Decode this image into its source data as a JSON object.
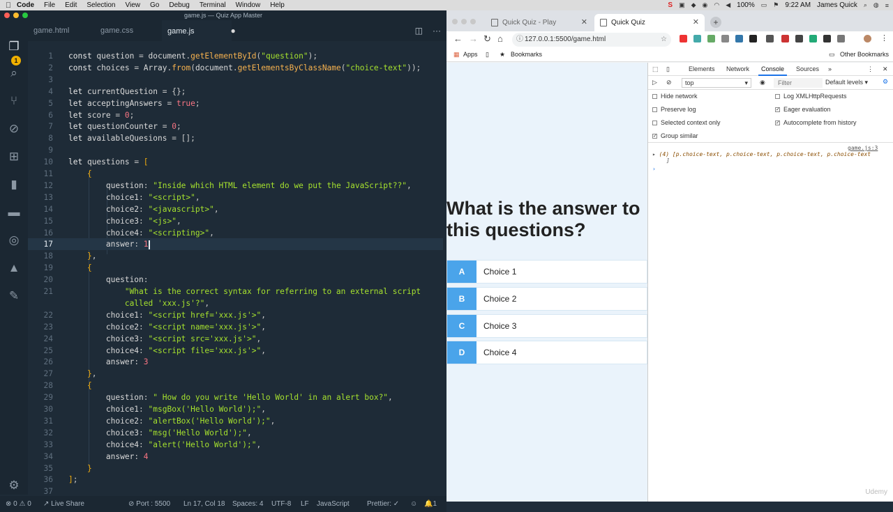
{
  "menubar": {
    "app": "Code",
    "items": [
      "File",
      "Edit",
      "Selection",
      "View",
      "Go",
      "Debug",
      "Terminal",
      "Window",
      "Help"
    ],
    "battery": "100%",
    "time": "9:22 AM",
    "user": "James Quick"
  },
  "vscode": {
    "title": "game.js — Quiz App Master",
    "tabs": [
      {
        "label": "game.html"
      },
      {
        "label": "game.css"
      },
      {
        "label": "game.js"
      }
    ],
    "notification_count": "1",
    "status": {
      "errors": "0",
      "warnings": "0",
      "live_share": "Live Share",
      "port": "Port : 5500",
      "position": "Ln 17, Col 18",
      "spaces": "Spaces: 4",
      "encoding": "UTF-8",
      "eol": "LF",
      "language": "JavaScript",
      "prettier": "Prettier:",
      "bell_count": "1"
    }
  },
  "code_lines": [
    {
      "n": "1",
      "tokens": [
        [
          "k",
          "const "
        ],
        [
          "v",
          "question "
        ],
        [
          "p",
          "= "
        ],
        [
          "v",
          "document"
        ],
        [
          "p",
          "."
        ],
        [
          "f",
          "getElementById"
        ],
        [
          "p",
          "("
        ],
        [
          "s",
          "\"question\""
        ],
        [
          "p",
          ");"
        ]
      ]
    },
    {
      "n": "2",
      "tokens": [
        [
          "k",
          "const "
        ],
        [
          "v",
          "choices "
        ],
        [
          "p",
          "= "
        ],
        [
          "v",
          "Array"
        ],
        [
          "p",
          "."
        ],
        [
          "f",
          "from"
        ],
        [
          "p",
          "("
        ],
        [
          "v",
          "document"
        ],
        [
          "p",
          "."
        ],
        [
          "f",
          "getElementsByClassName"
        ],
        [
          "p",
          "("
        ],
        [
          "s",
          "\"choice-text\""
        ],
        [
          "p",
          "));"
        ]
      ]
    },
    {
      "n": "3",
      "tokens": []
    },
    {
      "n": "4",
      "tokens": [
        [
          "k",
          "let "
        ],
        [
          "v",
          "currentQuestion "
        ],
        [
          "p",
          "= {};"
        ]
      ]
    },
    {
      "n": "5",
      "tokens": [
        [
          "k",
          "let "
        ],
        [
          "v",
          "acceptingAnswers "
        ],
        [
          "p",
          "= "
        ],
        [
          "n",
          "true"
        ],
        [
          "p",
          ";"
        ]
      ]
    },
    {
      "n": "6",
      "tokens": [
        [
          "k",
          "let "
        ],
        [
          "v",
          "score "
        ],
        [
          "p",
          "= "
        ],
        [
          "n",
          "0"
        ],
        [
          "p",
          ";"
        ]
      ]
    },
    {
      "n": "7",
      "tokens": [
        [
          "k",
          "let "
        ],
        [
          "v",
          "questionCounter "
        ],
        [
          "p",
          "= "
        ],
        [
          "n",
          "0"
        ],
        [
          "p",
          ";"
        ]
      ]
    },
    {
      "n": "8",
      "tokens": [
        [
          "k",
          "let "
        ],
        [
          "v",
          "availableQuesions "
        ],
        [
          "p",
          "= [];"
        ]
      ]
    },
    {
      "n": "9",
      "tokens": []
    },
    {
      "n": "10",
      "tokens": [
        [
          "k",
          "let "
        ],
        [
          "v",
          "questions "
        ],
        [
          "p",
          "= "
        ],
        [
          "b",
          "["
        ]
      ]
    },
    {
      "n": "11",
      "tokens": [
        [
          "p",
          "    "
        ],
        [
          "b",
          "{"
        ]
      ]
    },
    {
      "n": "12",
      "tokens": [
        [
          "p",
          "        "
        ],
        [
          "v",
          "question"
        ],
        [
          "p",
          ": "
        ],
        [
          "s",
          "\"Inside which HTML element do we put the JavaScript??\""
        ],
        [
          "p",
          ","
        ]
      ]
    },
    {
      "n": "13",
      "tokens": [
        [
          "p",
          "        "
        ],
        [
          "v",
          "choice1"
        ],
        [
          "p",
          ": "
        ],
        [
          "s",
          "\"<script>\""
        ],
        [
          "p",
          ","
        ]
      ]
    },
    {
      "n": "14",
      "tokens": [
        [
          "p",
          "        "
        ],
        [
          "v",
          "choice2"
        ],
        [
          "p",
          ": "
        ],
        [
          "s",
          "\"<javascript>\""
        ],
        [
          "p",
          ","
        ]
      ]
    },
    {
      "n": "15",
      "tokens": [
        [
          "p",
          "        "
        ],
        [
          "v",
          "choice3"
        ],
        [
          "p",
          ": "
        ],
        [
          "s",
          "\"<js>\""
        ],
        [
          "p",
          ","
        ]
      ]
    },
    {
      "n": "16",
      "tokens": [
        [
          "p",
          "        "
        ],
        [
          "v",
          "choice4"
        ],
        [
          "p",
          ": "
        ],
        [
          "s",
          "\"<scripting>\""
        ],
        [
          "p",
          ","
        ]
      ]
    },
    {
      "n": "17",
      "tokens": [
        [
          "p",
          "        "
        ],
        [
          "v",
          "answer"
        ],
        [
          "p",
          ": "
        ],
        [
          "n",
          "1"
        ]
      ],
      "current": true
    },
    {
      "n": "18",
      "tokens": [
        [
          "p",
          "    "
        ],
        [
          "b",
          "}"
        ],
        [
          "p",
          ","
        ]
      ]
    },
    {
      "n": "19",
      "tokens": [
        [
          "p",
          "    "
        ],
        [
          "b",
          "{"
        ]
      ]
    },
    {
      "n": "20",
      "tokens": [
        [
          "p",
          "        "
        ],
        [
          "v",
          "question"
        ],
        [
          "p",
          ":"
        ]
      ]
    },
    {
      "n": "21",
      "tokens": [
        [
          "p",
          "            "
        ],
        [
          "s",
          "\"What is the correct syntax for referring to an external script"
        ]
      ]
    },
    {
      "n": "",
      "tokens": [
        [
          "p",
          "            "
        ],
        [
          "s",
          "called 'xxx.js'?\""
        ],
        [
          "p",
          ","
        ]
      ]
    },
    {
      "n": "22",
      "tokens": [
        [
          "p",
          "        "
        ],
        [
          "v",
          "choice1"
        ],
        [
          "p",
          ": "
        ],
        [
          "s",
          "\"<script href='xxx.js'>\""
        ],
        [
          "p",
          ","
        ]
      ]
    },
    {
      "n": "23",
      "tokens": [
        [
          "p",
          "        "
        ],
        [
          "v",
          "choice2"
        ],
        [
          "p",
          ": "
        ],
        [
          "s",
          "\"<script name='xxx.js'>\""
        ],
        [
          "p",
          ","
        ]
      ]
    },
    {
      "n": "24",
      "tokens": [
        [
          "p",
          "        "
        ],
        [
          "v",
          "choice3"
        ],
        [
          "p",
          ": "
        ],
        [
          "s",
          "\"<script src='xxx.js'>\""
        ],
        [
          "p",
          ","
        ]
      ]
    },
    {
      "n": "25",
      "tokens": [
        [
          "p",
          "        "
        ],
        [
          "v",
          "choice4"
        ],
        [
          "p",
          ": "
        ],
        [
          "s",
          "\"<script file='xxx.js'>\""
        ],
        [
          "p",
          ","
        ]
      ]
    },
    {
      "n": "26",
      "tokens": [
        [
          "p",
          "        "
        ],
        [
          "v",
          "answer"
        ],
        [
          "p",
          ": "
        ],
        [
          "n",
          "3"
        ]
      ]
    },
    {
      "n": "27",
      "tokens": [
        [
          "p",
          "    "
        ],
        [
          "b",
          "}"
        ],
        [
          "p",
          ","
        ]
      ]
    },
    {
      "n": "28",
      "tokens": [
        [
          "p",
          "    "
        ],
        [
          "b",
          "{"
        ]
      ]
    },
    {
      "n": "29",
      "tokens": [
        [
          "p",
          "        "
        ],
        [
          "v",
          "question"
        ],
        [
          "p",
          ": "
        ],
        [
          "s",
          "\" How do you write 'Hello World' in an alert box?\""
        ],
        [
          "p",
          ","
        ]
      ]
    },
    {
      "n": "30",
      "tokens": [
        [
          "p",
          "        "
        ],
        [
          "v",
          "choice1"
        ],
        [
          "p",
          ": "
        ],
        [
          "s",
          "\"msgBox('Hello World');\""
        ],
        [
          "p",
          ","
        ]
      ]
    },
    {
      "n": "31",
      "tokens": [
        [
          "p",
          "        "
        ],
        [
          "v",
          "choice2"
        ],
        [
          "p",
          ": "
        ],
        [
          "s",
          "\"alertBox('Hello World');\""
        ],
        [
          "p",
          ","
        ]
      ]
    },
    {
      "n": "32",
      "tokens": [
        [
          "p",
          "        "
        ],
        [
          "v",
          "choice3"
        ],
        [
          "p",
          ": "
        ],
        [
          "s",
          "\"msg('Hello World');\""
        ],
        [
          "p",
          ","
        ]
      ]
    },
    {
      "n": "33",
      "tokens": [
        [
          "p",
          "        "
        ],
        [
          "v",
          "choice4"
        ],
        [
          "p",
          ": "
        ],
        [
          "s",
          "\"alert('Hello World');\""
        ],
        [
          "p",
          ","
        ]
      ]
    },
    {
      "n": "34",
      "tokens": [
        [
          "p",
          "        "
        ],
        [
          "v",
          "answer"
        ],
        [
          "p",
          ": "
        ],
        [
          "n",
          "4"
        ]
      ]
    },
    {
      "n": "35",
      "tokens": [
        [
          "p",
          "    "
        ],
        [
          "b",
          "}"
        ]
      ]
    },
    {
      "n": "36",
      "tokens": [
        [
          "b",
          "]"
        ],
        [
          "p",
          ";"
        ]
      ]
    },
    {
      "n": "37",
      "tokens": []
    }
  ],
  "browser": {
    "tabs": [
      {
        "label": "Quick Quiz - Play"
      },
      {
        "label": "Quick Quiz"
      }
    ],
    "url": "127.0.0.1:5500/game.html",
    "bookmarks": {
      "apps": "Apps",
      "bookmarks": "Bookmarks",
      "other": "Other Bookmarks"
    },
    "quiz": {
      "question": "What is the answer to this questions?",
      "choices": [
        {
          "prefix": "A",
          "text": "Choice 1"
        },
        {
          "prefix": "B",
          "text": "Choice 2"
        },
        {
          "prefix": "C",
          "text": "Choice 3"
        },
        {
          "prefix": "D",
          "text": "Choice 4"
        }
      ]
    },
    "devtools": {
      "tabs": [
        "Elements",
        "Network",
        "Console",
        "Sources"
      ],
      "active_tab": "Console",
      "context": "top",
      "filter_placeholder": "Filter",
      "levels": "Default levels",
      "options_left": [
        {
          "label": "Hide network",
          "checked": false
        },
        {
          "label": "Preserve log",
          "checked": false
        },
        {
          "label": "Selected context only",
          "checked": false
        },
        {
          "label": "Group similar",
          "checked": true
        }
      ],
      "options_right": [
        {
          "label": "Log XMLHttpRequests",
          "checked": false
        },
        {
          "label": "Eager evaluation",
          "checked": true
        },
        {
          "label": "Autocomplete from history",
          "checked": true
        }
      ],
      "log_source": "game.js:3",
      "log_text": "(4) [p.choice-text, p.choice-text, p.choice-text, p.choice-text",
      "log_close": "]"
    }
  },
  "watermark": "Udemy"
}
